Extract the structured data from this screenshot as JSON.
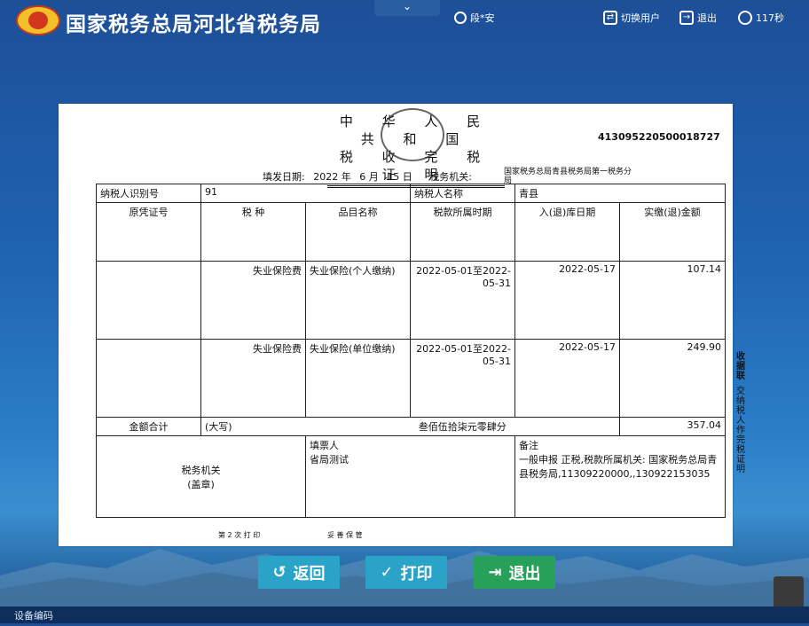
{
  "header": {
    "site_title": "国家税务总局河北省税务局",
    "dropdown_glyph": "⌄",
    "user_name": "段*安",
    "switch_user_label": "切换用户",
    "logout_label": "退出",
    "timer_label": "117秒"
  },
  "certificate": {
    "title_line1": "中 华 人 民 共 和 国",
    "title_line2": "税 收 完 税 证 明",
    "cert_number": "413095220500018727",
    "fill_date_label": "填发日期:",
    "fill_year": "2022 年",
    "fill_month": "6 月",
    "fill_day": "15 日",
    "tax_office_label": "税务机关:",
    "tax_office_value": "国家税务总局青县税务局第一税务分局",
    "taxpayer_id_label": "纳税人识别号",
    "taxpayer_id_value": "91",
    "taxpayer_name_label": "纳税人名称",
    "taxpayer_name_value": "青县",
    "columns": [
      "原凭证号",
      "税 种",
      "品目名称",
      "税款所属时期",
      "入(退)库日期",
      "实缴(退)金额"
    ],
    "rows": [
      {
        "voucher": "",
        "tax_type": "失业保险费",
        "item": "失业保险(个人缴纳)",
        "period": "2022-05-01至2022-05-31",
        "date": "2022-05-17",
        "amount": "107.14"
      },
      {
        "voucher": "",
        "tax_type": "失业保险费",
        "item": "失业保险(单位缴纳)",
        "period": "2022-05-01至2022-05-31",
        "date": "2022-05-17",
        "amount": "249.90"
      }
    ],
    "total_label": "金额合计",
    "total_upper_label": "(大写)",
    "total_upper_value": "叁佰伍拾柒元零肆分",
    "total_value": "357.04",
    "tax_authority_label": "税务机关",
    "seal_label": "(盖章)",
    "issuer_label": "填票人",
    "issuer_value": "省局测试",
    "remark_label": "备注",
    "remark_value": "一般申报 正税,税款所属机关: 国家税务总局青县税务局,11309220000,,130922153035",
    "side_label_1": "收据联",
    "side_label_2": "交纳税人作完税证明",
    "print_count": "第 2 次 打 印",
    "keep_note": "妥 善 保 管"
  },
  "actions": {
    "back_label": "返回",
    "print_label": "打印",
    "exit_label": "退出"
  },
  "bottom_bar": {
    "label": "设备编码"
  }
}
